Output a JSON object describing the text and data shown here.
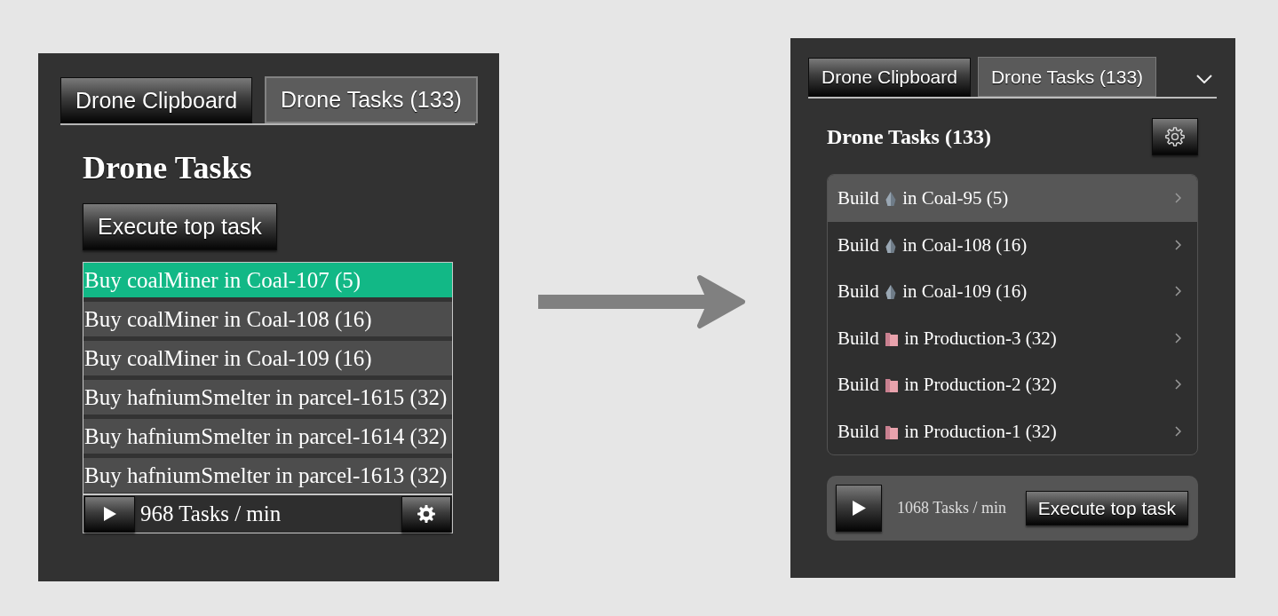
{
  "left_panel": {
    "tabs": [
      {
        "label": "Drone Clipboard",
        "selected": false
      },
      {
        "label": "Drone Tasks (133)",
        "selected": true
      }
    ],
    "heading": "Drone Tasks",
    "execute_button": "Execute top task",
    "tasks": [
      {
        "label": "Buy coalMiner in Coal-107 (5)",
        "selected": true
      },
      {
        "label": "Buy coalMiner in Coal-108 (16)",
        "selected": false
      },
      {
        "label": "Buy coalMiner in Coal-109 (16)",
        "selected": false
      },
      {
        "label": "Buy hafniumSmelter in parcel-1615 (32)",
        "selected": false
      },
      {
        "label": "Buy hafniumSmelter in parcel-1614 (32)",
        "selected": false
      },
      {
        "label": "Buy hafniumSmelter in parcel-1613 (32)",
        "selected": false
      }
    ],
    "footer": {
      "rate": "968 Tasks / min"
    }
  },
  "right_panel": {
    "tabs": [
      {
        "label": "Drone Clipboard",
        "selected": false
      },
      {
        "label": "Drone Tasks (133)",
        "selected": true
      }
    ],
    "heading": "Drone Tasks (133)",
    "tasks": [
      {
        "action": "Build",
        "kind": "coal",
        "location": "in Coal-95 (5)",
        "selected": true
      },
      {
        "action": "Build",
        "kind": "coal",
        "location": "in Coal-108 (16)",
        "selected": false
      },
      {
        "action": "Build",
        "kind": "coal",
        "location": "in Coal-109 (16)",
        "selected": false
      },
      {
        "action": "Build",
        "kind": "production",
        "location": "in Production-3 (32)",
        "selected": false
      },
      {
        "action": "Build",
        "kind": "production",
        "location": "in Production-2 (32)",
        "selected": false
      },
      {
        "action": "Build",
        "kind": "production",
        "location": "in Production-1 (32)",
        "selected": false
      }
    ],
    "footer": {
      "rate": "1068 Tasks / min",
      "execute_button": "Execute top task"
    }
  }
}
